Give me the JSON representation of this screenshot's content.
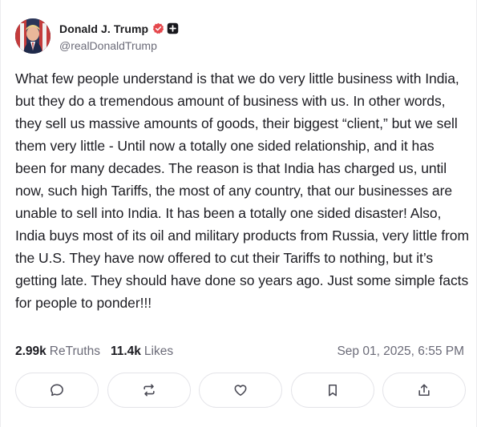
{
  "post": {
    "author": {
      "display_name": "Donald J. Trump",
      "handle": "@realDonaldTrump",
      "avatar_icon": "profile-avatar",
      "verified_icon": "verified-badge-icon",
      "verified_color": "#e5484d",
      "plus_icon": "plus-badge-icon"
    },
    "text": "What few people understand is that we do very little business with India, but they do a tremendous amount of business with us. In other words, they sell us massive amounts of goods, their biggest “client,” but we sell them very little - Until now a totally one sided relationship, and it has been for many decades. The reason is that India has charged us, until now, such high Tariffs, the most of any country, that our businesses are unable to sell into India. It has been a totally one sided disaster! Also, India buys most of its oil and military products from Russia, very little from the U.S. They have now offered to cut their Tariffs to nothing, but it’s getting late. They should have done so years ago. Just some simple facts for people to ponder!!!",
    "stats": {
      "retruths_count": "2.99k",
      "retruths_label": "ReTruths",
      "likes_count": "11.4k",
      "likes_label": "Likes"
    },
    "timestamp": "Sep 01, 2025, 6:55 PM",
    "actions": [
      {
        "name": "reply-button",
        "icon": "comment-icon"
      },
      {
        "name": "retruth-button",
        "icon": "repost-icon"
      },
      {
        "name": "like-button",
        "icon": "heart-icon"
      },
      {
        "name": "bookmark-button",
        "icon": "bookmark-icon"
      },
      {
        "name": "share-button",
        "icon": "share-icon"
      }
    ]
  }
}
